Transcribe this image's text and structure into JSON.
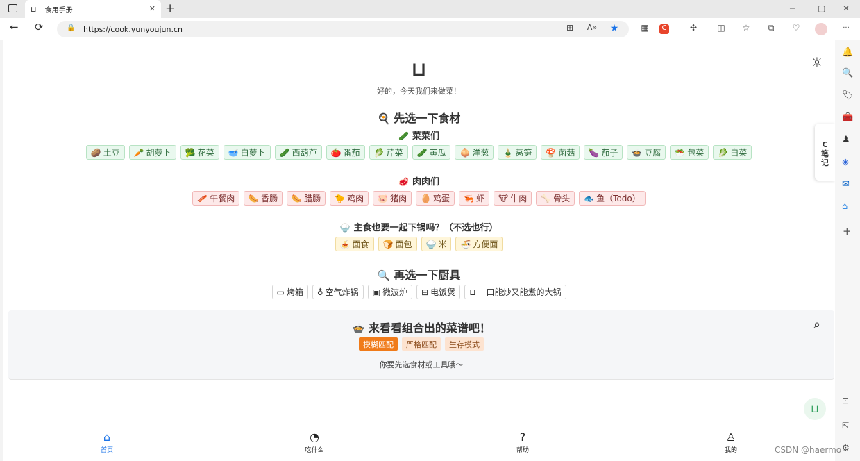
{
  "browser": {
    "tab_title": "食用手册",
    "url": "https://cook.yunyoujun.cn",
    "win_min": "─",
    "win_max": "▢",
    "win_close": "✕",
    "new_tab": "+",
    "back": "←",
    "reload": "⟳",
    "more": "···"
  },
  "header": {
    "logo": "⊔",
    "greeting": "好的，今天我们来做菜！",
    "theme_icon": "☼"
  },
  "ingredients": {
    "title_icon": "🍳",
    "title": "先选一下食材",
    "vegetables": {
      "icon": "🥒",
      "title": "菜菜们",
      "items": [
        {
          "icon": "🥔",
          "label": "土豆"
        },
        {
          "icon": "🥕",
          "label": "胡萝卜"
        },
        {
          "icon": "🥦",
          "label": "花菜"
        },
        {
          "icon": "🥣",
          "label": "白萝卜"
        },
        {
          "icon": "🥒",
          "label": "西葫芦"
        },
        {
          "icon": "🍅",
          "label": "番茄"
        },
        {
          "icon": "🥬",
          "label": "芹菜"
        },
        {
          "icon": "🥒",
          "label": "黄瓜"
        },
        {
          "icon": "🧅",
          "label": "洋葱"
        },
        {
          "icon": "🎍",
          "label": "莴笋"
        },
        {
          "icon": "🍄",
          "label": "菌菇"
        },
        {
          "icon": "🍆",
          "label": "茄子"
        },
        {
          "icon": "🍲",
          "label": "豆腐"
        },
        {
          "icon": "🥗",
          "label": "包菜"
        },
        {
          "icon": "🥬",
          "label": "白菜"
        }
      ]
    },
    "meats": {
      "icon": "🥩",
      "title": "肉肉们",
      "items": [
        {
          "icon": "🥓",
          "label": "午餐肉"
        },
        {
          "icon": "🌭",
          "label": "香肠"
        },
        {
          "icon": "🌭",
          "label": "腊肠"
        },
        {
          "icon": "🐤",
          "label": "鸡肉"
        },
        {
          "icon": "🐷",
          "label": "猪肉"
        },
        {
          "icon": "🥚",
          "label": "鸡蛋"
        },
        {
          "icon": "🦐",
          "label": "虾"
        },
        {
          "icon": "🐮",
          "label": "牛肉"
        },
        {
          "icon": "🦴",
          "label": "骨头"
        },
        {
          "icon": "🐟",
          "label": "鱼（Todo）"
        }
      ]
    },
    "staples": {
      "icon": "🍚",
      "title": "主食也要一起下锅吗？（不选也行）",
      "items": [
        {
          "icon": "🍝",
          "label": "面食"
        },
        {
          "icon": "🍞",
          "label": "面包"
        },
        {
          "icon": "🍚",
          "label": "米"
        },
        {
          "icon": "🍜",
          "label": "方便面"
        }
      ]
    }
  },
  "tools": {
    "title_icon": "🔍",
    "title": "再选一下厨具",
    "items": [
      {
        "icon": "▭",
        "label": "烤箱"
      },
      {
        "icon": "♁",
        "label": "空气炸锅"
      },
      {
        "icon": "▣",
        "label": "微波炉"
      },
      {
        "icon": "⊟",
        "label": "电饭煲"
      },
      {
        "icon": "⊔",
        "label": "一口能炒又能煮的大锅"
      }
    ]
  },
  "result": {
    "title_icon": "🍲",
    "title": "来看看组合出的菜谱吧！",
    "search_icon": "⌕",
    "modes": [
      "模糊匹配",
      "严格匹配",
      "生存模式"
    ],
    "hint": "你要先选食材或工具哦～"
  },
  "fab_icon": "⊔",
  "bottom_nav": [
    {
      "icon": "⌂",
      "label": "首页"
    },
    {
      "icon": "◔",
      "label": "吃什么"
    },
    {
      "icon": "?",
      "label": "帮助"
    },
    {
      "icon": "♙",
      "label": "我的"
    }
  ],
  "notes_tab": "C\n笔\n记",
  "watermark": "CSDN @haermo"
}
